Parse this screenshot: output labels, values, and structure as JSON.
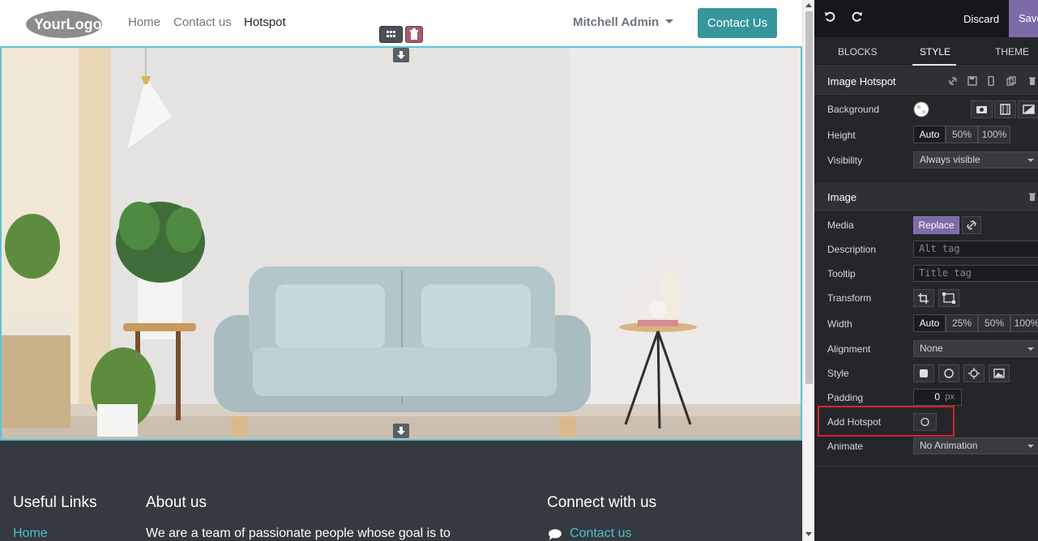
{
  "site": {
    "logo_text": "YourLogo",
    "nav": [
      {
        "label": "Home"
      },
      {
        "label": "Contact us"
      },
      {
        "label": "Hotspot"
      }
    ],
    "user_menu": "Mitchell Admin",
    "contact_button": "Contact Us",
    "footer": {
      "useful_links_heading": "Useful Links",
      "useful_links_first": "Home",
      "about_heading": "About us",
      "about_text": "We are a team of passionate people whose goal is to",
      "connect_heading": "Connect with us",
      "connect_link": "Contact us"
    }
  },
  "editor": {
    "discard": "Discard",
    "save": "Save",
    "tabs": [
      {
        "label": "BLOCKS"
      },
      {
        "label": "STYLE"
      },
      {
        "label": "THEME"
      }
    ],
    "active_tab": "STYLE",
    "hotspot_section": {
      "title": "Image Hotspot",
      "background_label": "Background",
      "height_label": "Height",
      "height_options": [
        "Auto",
        "50%",
        "100%"
      ],
      "height_selected": "Auto",
      "visibility_label": "Visibility",
      "visibility_value": "Always visible"
    },
    "image_section": {
      "title": "Image",
      "media_label": "Media",
      "replace_label": "Replace",
      "description_label": "Description",
      "description_placeholder": "Alt tag",
      "tooltip_label": "Tooltip",
      "tooltip_placeholder": "Title tag",
      "transform_label": "Transform",
      "width_label": "Width",
      "width_options": [
        "Auto",
        "25%",
        "50%",
        "100%"
      ],
      "width_selected": "Auto",
      "alignment_label": "Alignment",
      "alignment_value": "None",
      "style_label": "Style",
      "padding_label": "Padding",
      "padding_value": "0",
      "padding_unit": "px",
      "add_hotspot_label": "Add Hotspot",
      "animate_label": "Animate",
      "animate_value": "No Animation"
    }
  },
  "colors": {
    "accent": "#35979c",
    "editor_bg": "#25262a",
    "save_purple": "#7c6ba8",
    "highlight_red": "#d6242c"
  }
}
